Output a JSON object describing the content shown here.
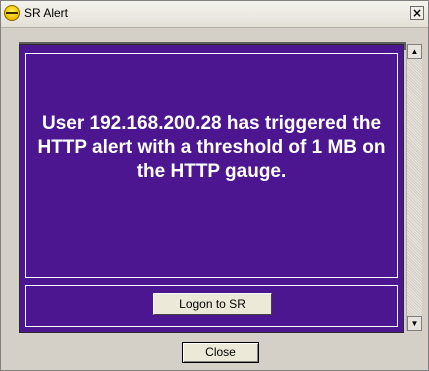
{
  "window": {
    "title": "SR Alert",
    "close_glyph": "×",
    "icon": "sr-logo-icon"
  },
  "alert": {
    "message": "User 192.168.200.28 has triggered the HTTP alert with a threshold of 1 MB on the HTTP gauge.",
    "logon_button": "Logon to SR"
  },
  "scrollbar": {
    "up_glyph": "▲",
    "down_glyph": "▼"
  },
  "footer": {
    "close_button": "Close"
  },
  "colors": {
    "alert_background": "#4b1690",
    "alert_text": "#ffffff",
    "dialog_background": "#d4d0c8"
  }
}
